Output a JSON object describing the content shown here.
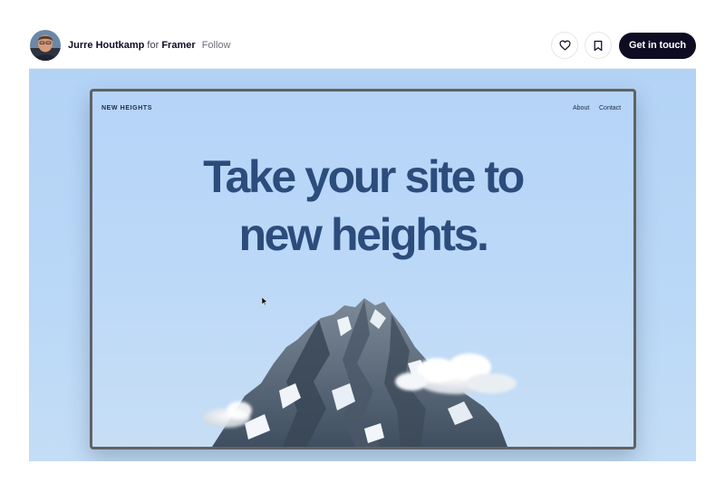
{
  "header": {
    "author_name": "Jurre Houtkamp",
    "for_word": "for",
    "team_name": "Framer",
    "follow_label": "Follow",
    "cta_label": "Get in touch",
    "like_icon": "heart-icon",
    "save_icon": "bookmark-icon"
  },
  "shot": {
    "site_logo": "NEW HEIGHTS",
    "nav": [
      "About",
      "Contact"
    ],
    "hero_line_1": "Take your site to",
    "hero_line_2": "new heights."
  },
  "colors": {
    "cta_background": "#0d0c22",
    "hero_text": "#2c4c7c",
    "sky": "#b5d4f8"
  }
}
